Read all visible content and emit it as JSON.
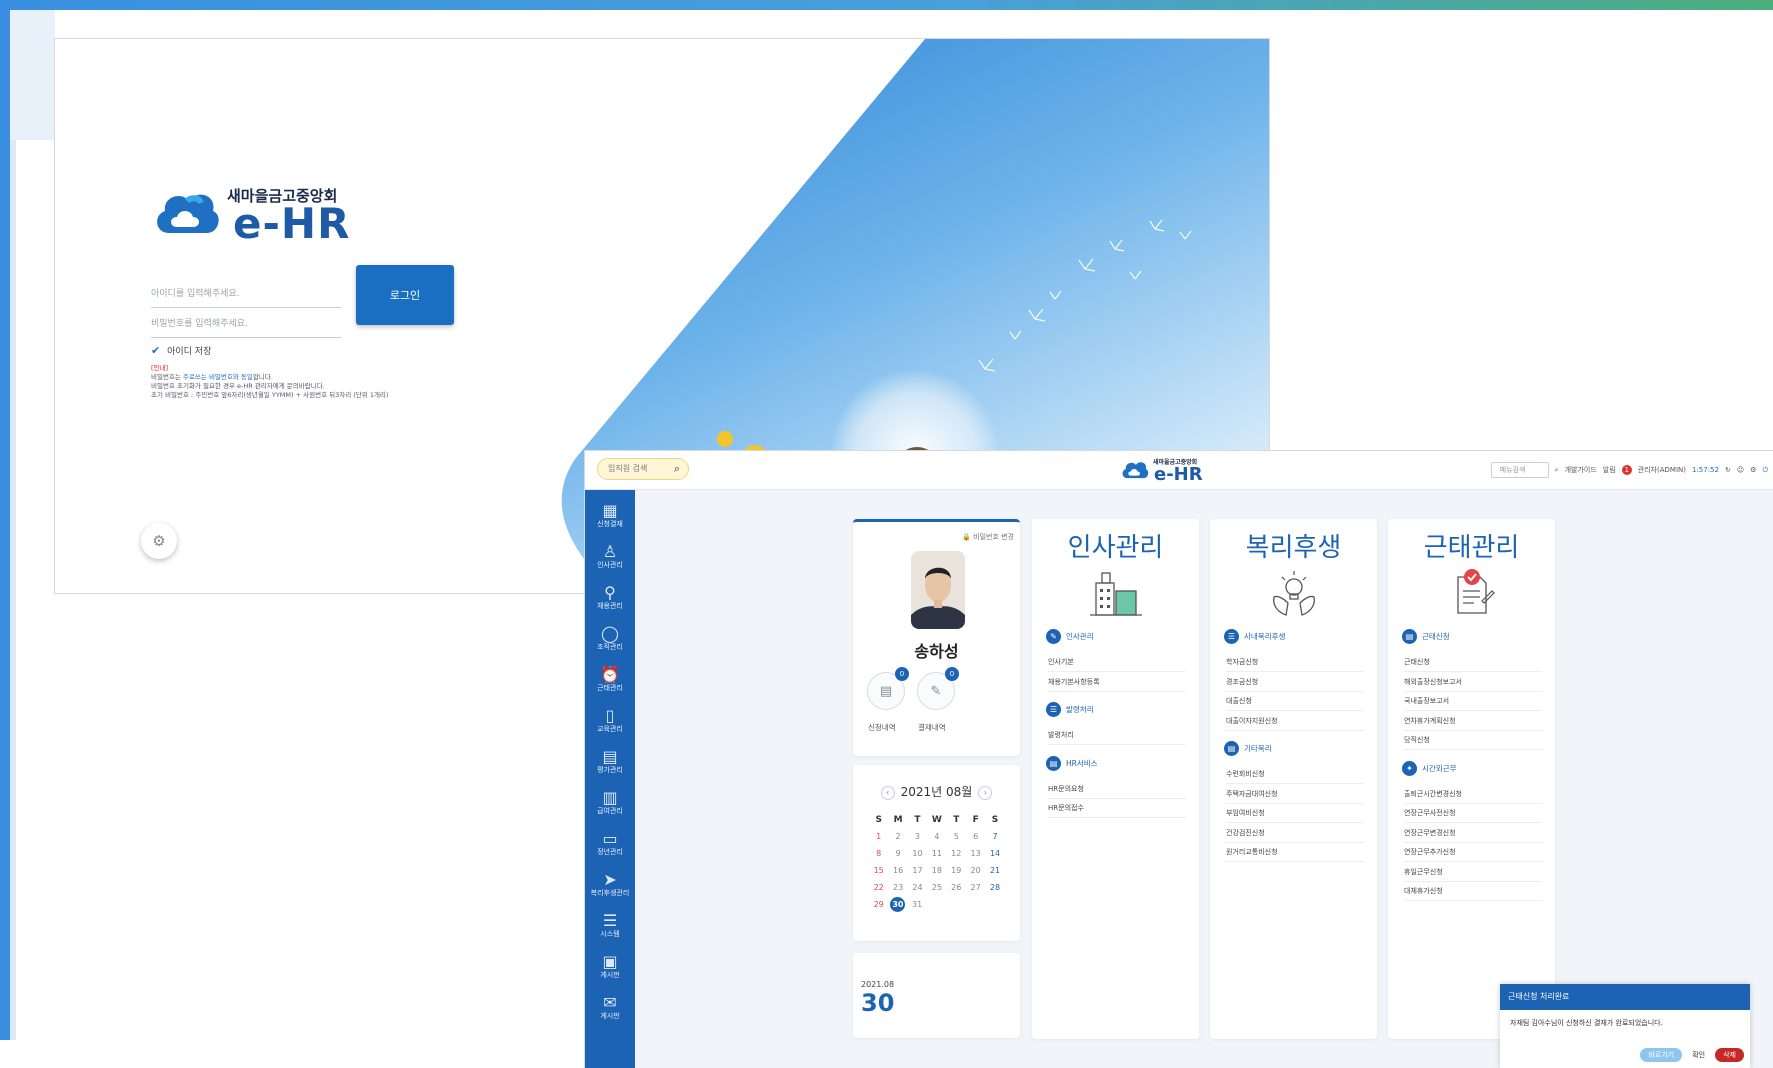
{
  "login": {
    "org_name": "새마을금고중앙회",
    "brand": "e-HR",
    "id_placeholder": "아이디를 입력해주세요.",
    "pw_placeholder": "비밀번호를 입력해주세요.",
    "login_button": "로그인",
    "save_id": "아이디 저장",
    "notice_title": "[안내]",
    "notice_line1a": "비밀번호는 ",
    "notice_line1b": "주로쓰는 비밀번호와 동일",
    "notice_line1c": "합니다.",
    "notice_line2": "비밀번호 초기화가 필요한 경우 e-HR 관리자에게 문의바랍니다.",
    "notice_line3": "초기 비밀번호 : 주민번호 앞6자리(생년월일 YYMM) + 사원번호 뒤3자리 (단위 1개리)"
  },
  "header": {
    "emp_search": "임직원 검색",
    "org_name": "새마을금고중앙회",
    "brand": "e-HR",
    "menu_search": "메뉴검색",
    "guide": "개발가이드",
    "alarm": "알림",
    "alarm_count": "1",
    "user": "관리자(ADMIN)",
    "time": "1:57:52"
  },
  "lnb": [
    {
      "label": "신청결재",
      "icon": "calendar-icon"
    },
    {
      "label": "인사관리",
      "icon": "person-icon"
    },
    {
      "label": "채용관리",
      "icon": "user-search-icon"
    },
    {
      "label": "조직관리",
      "icon": "chat-icon"
    },
    {
      "label": "근태관리",
      "icon": "alarm-icon"
    },
    {
      "label": "교육관리",
      "icon": "book-icon"
    },
    {
      "label": "평가관리",
      "icon": "clipboard-icon"
    },
    {
      "label": "급여관리",
      "icon": "calculator-icon"
    },
    {
      "label": "정년관리",
      "icon": "board-icon"
    },
    {
      "label": "복리후생관리",
      "icon": "send-icon"
    },
    {
      "label": "시스템",
      "icon": "sliders-icon"
    },
    {
      "label": "게시판",
      "icon": "archive-icon"
    },
    {
      "label": "게시판",
      "icon": "message-icon"
    }
  ],
  "profile": {
    "pw_change": "비밀번호 변경",
    "name": "송하성",
    "apply_count": "0",
    "apply_label": "신청내역",
    "approve_count": "0",
    "approve_label": "결재내역"
  },
  "calendar": {
    "title": "2021년 08월",
    "dow": [
      "S",
      "M",
      "T",
      "W",
      "T",
      "F",
      "S"
    ],
    "weeks": [
      [
        "1",
        "2",
        "3",
        "4",
        "5",
        "6",
        "7"
      ],
      [
        "8",
        "9",
        "10",
        "11",
        "12",
        "13",
        "14"
      ],
      [
        "15",
        "16",
        "17",
        "18",
        "19",
        "20",
        "21"
      ],
      [
        "22",
        "23",
        "24",
        "25",
        "26",
        "27",
        "28"
      ],
      [
        "29",
        "30",
        "31",
        "",
        "",
        "",
        ""
      ]
    ],
    "today": "30"
  },
  "datecard": {
    "ym": "2021.08",
    "day": "30"
  },
  "cards": [
    {
      "title": "인사관리",
      "sections": [
        {
          "name": "인사관리",
          "items": [
            "인사기본",
            "채용기본사항등록"
          ]
        },
        {
          "name": "발령처리",
          "items": [
            "발령처리"
          ]
        },
        {
          "name": "HR서비스",
          "items": [
            "HR문의요청",
            "HR문의접수"
          ]
        }
      ]
    },
    {
      "title": "복리후생",
      "sections": [
        {
          "name": "사내복리후생",
          "items": [
            "학자금신청",
            "경조금신청",
            "대출신청",
            "대출이자지원신청"
          ]
        },
        {
          "name": "기타복리",
          "items": [
            "수련회비신청",
            "주택자금대여신청",
            "부임여비신청",
            "건강검진신청",
            "원거리교통비신청"
          ]
        }
      ]
    },
    {
      "title": "근태관리",
      "sections": [
        {
          "name": "근태신청",
          "items": [
            "근태신청",
            "해외출장신청보고서",
            "국내출장보고서",
            "연차휴가계획신청",
            "당직신청"
          ]
        },
        {
          "name": "시간외근무",
          "items": [
            "출퇴근시간변경신청",
            "연장근무사전신청",
            "연장근무변경신청",
            "연장근무추가신청",
            "휴일근무신청",
            "대체휴가신청"
          ]
        }
      ]
    }
  ],
  "toast": {
    "title": "근태신청 처리완료",
    "body": "자재팀 김아수님이 신청하신 결재가 완료되었습니다.",
    "btn_later": "바로가기",
    "btn_ok": "확인",
    "btn_delete": "삭제"
  }
}
